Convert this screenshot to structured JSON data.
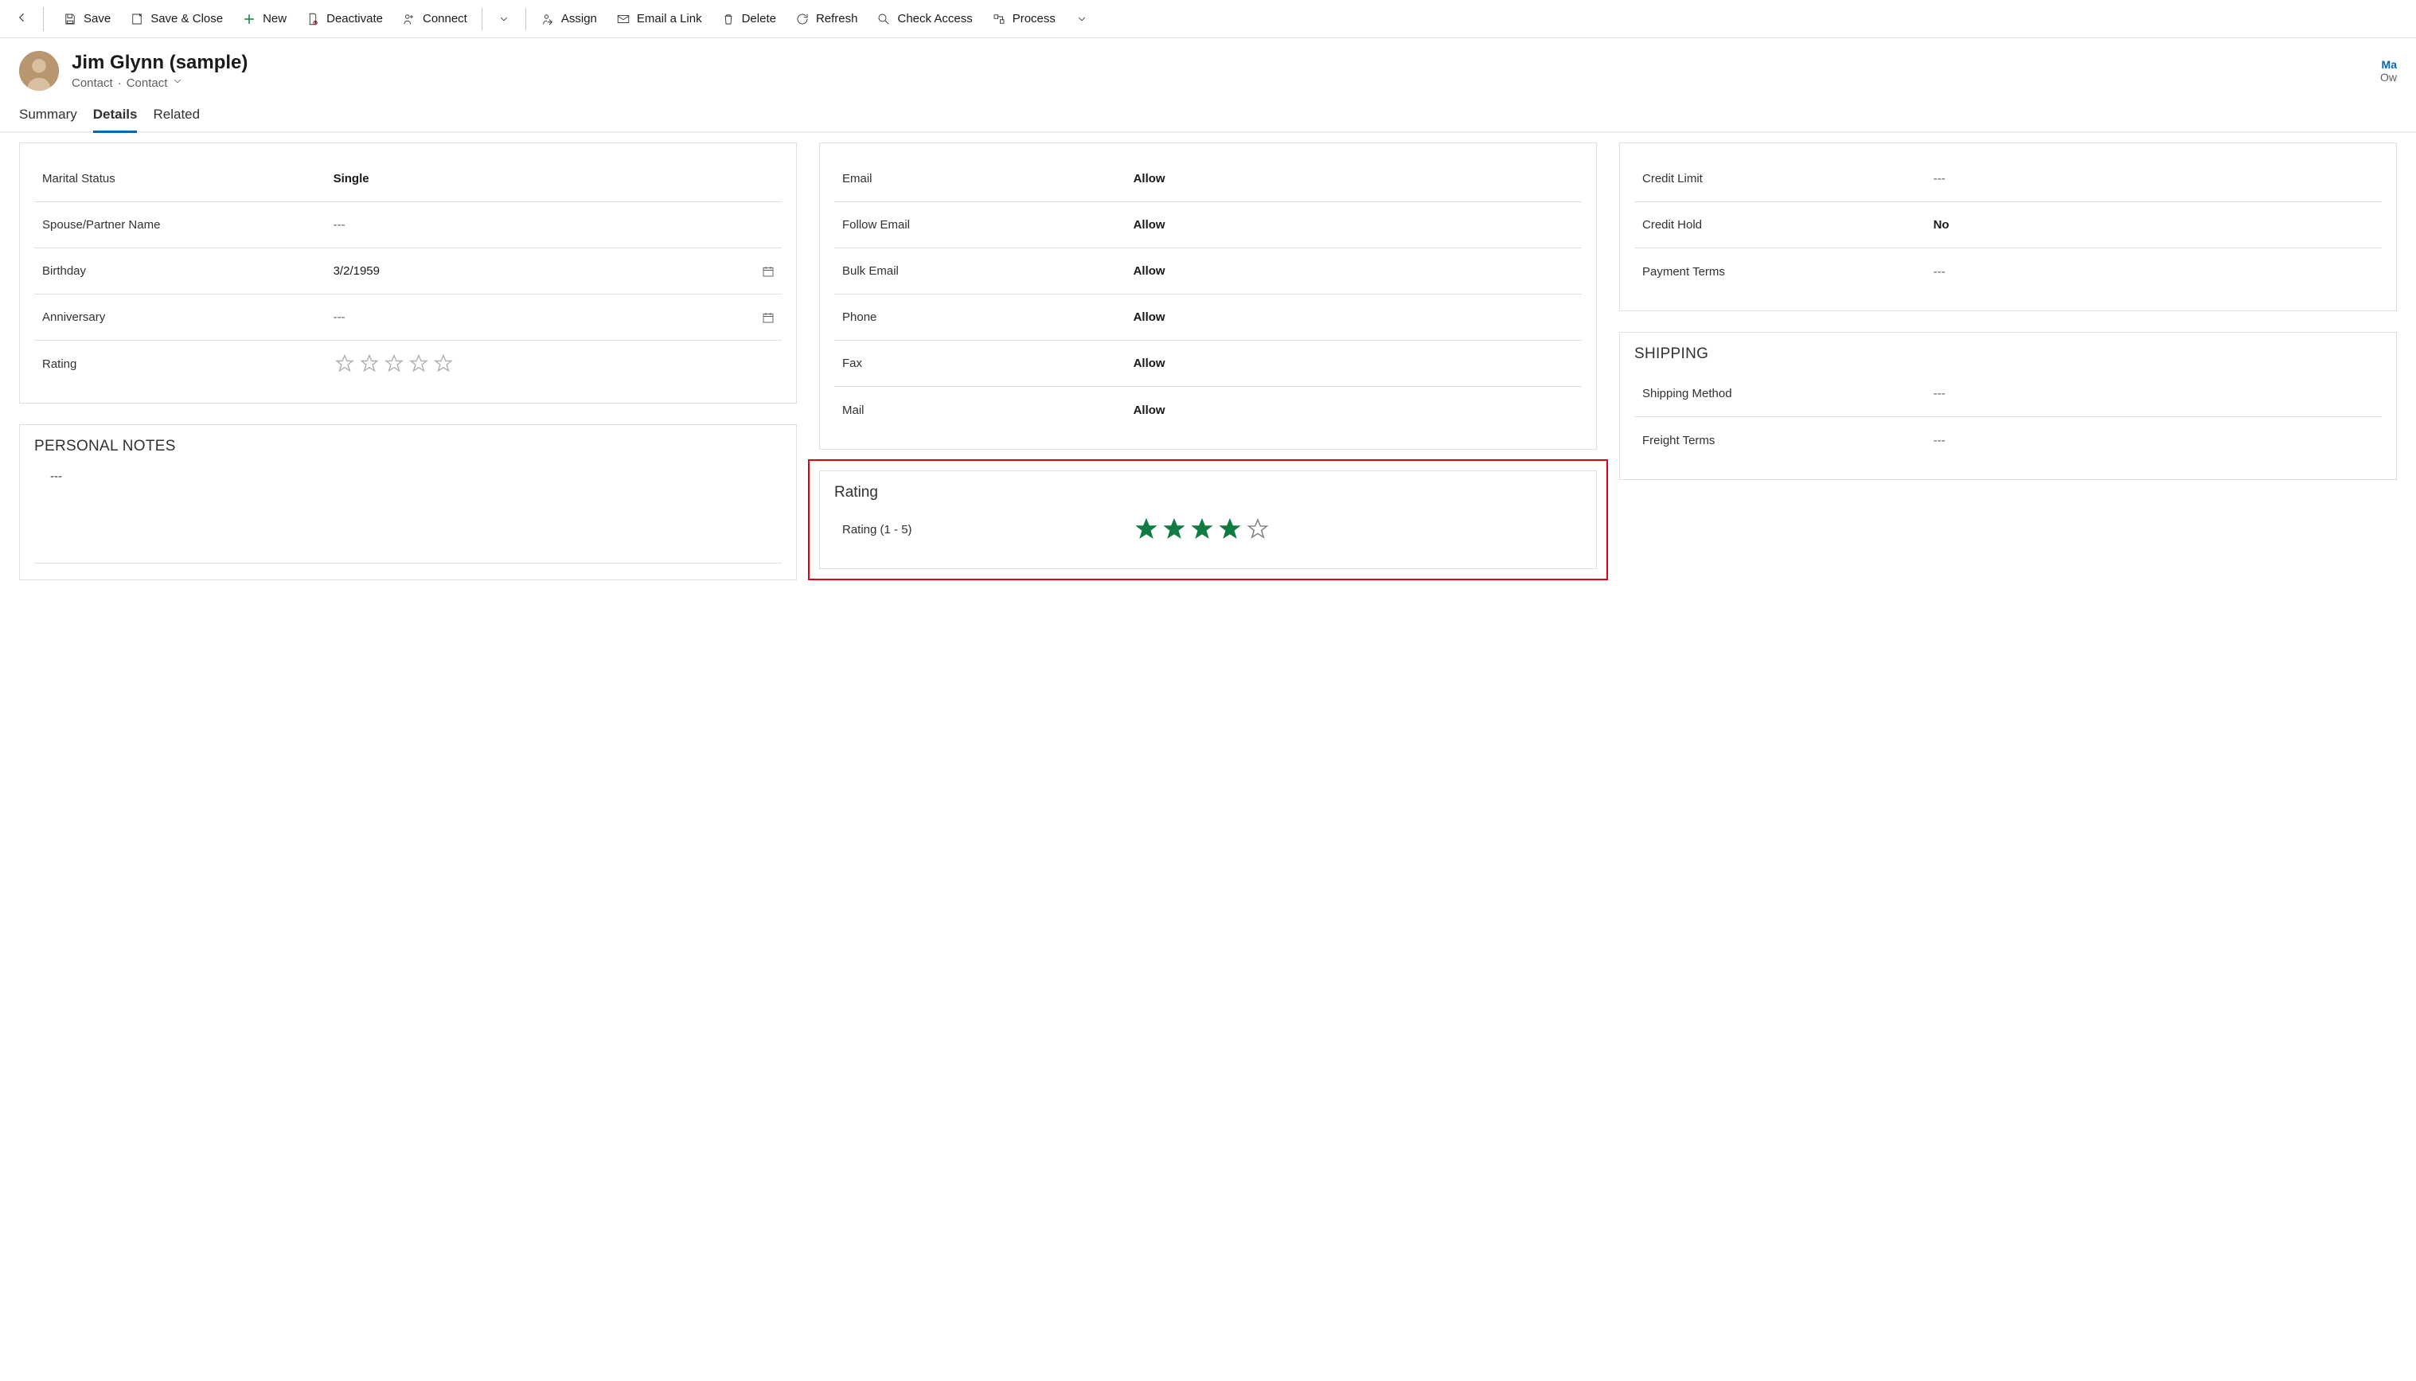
{
  "toolbar": {
    "save": "Save",
    "save_close": "Save & Close",
    "new": "New",
    "deactivate": "Deactivate",
    "connect": "Connect",
    "assign": "Assign",
    "email_link": "Email a Link",
    "delete": "Delete",
    "refresh": "Refresh",
    "check_access": "Check Access",
    "process": "Process"
  },
  "header": {
    "title": "Jim Glynn (sample)",
    "entity": "Contact",
    "form": "Contact",
    "right_top": "Ma",
    "right_bottom": "Ow"
  },
  "tabs": {
    "summary": "Summary",
    "details": "Details",
    "related": "Related"
  },
  "personal": {
    "marital_status_label": "Marital Status",
    "marital_status_value": "Single",
    "spouse_label": "Spouse/Partner Name",
    "spouse_value": "---",
    "birthday_label": "Birthday",
    "birthday_value": "3/2/1959",
    "anniversary_label": "Anniversary",
    "anniversary_value": "---",
    "rating_label": "Rating"
  },
  "personal_notes": {
    "title": "PERSONAL NOTES",
    "value": "---"
  },
  "contact_prefs": {
    "email_label": "Email",
    "email_value": "Allow",
    "follow_label": "Follow Email",
    "follow_value": "Allow",
    "bulk_label": "Bulk Email",
    "bulk_value": "Allow",
    "phone_label": "Phone",
    "phone_value": "Allow",
    "fax_label": "Fax",
    "fax_value": "Allow",
    "mail_label": "Mail",
    "mail_value": "Allow"
  },
  "rating_card": {
    "title": "Rating",
    "field_label": "Rating (1 - 5)",
    "value": 4,
    "max": 5
  },
  "billing": {
    "credit_limit_label": "Credit Limit",
    "credit_limit_value": "---",
    "credit_hold_label": "Credit Hold",
    "credit_hold_value": "No",
    "payment_terms_label": "Payment Terms",
    "payment_terms_value": "---"
  },
  "shipping": {
    "title": "SHIPPING",
    "method_label": "Shipping Method",
    "method_value": "---",
    "freight_label": "Freight Terms",
    "freight_value": "---"
  }
}
